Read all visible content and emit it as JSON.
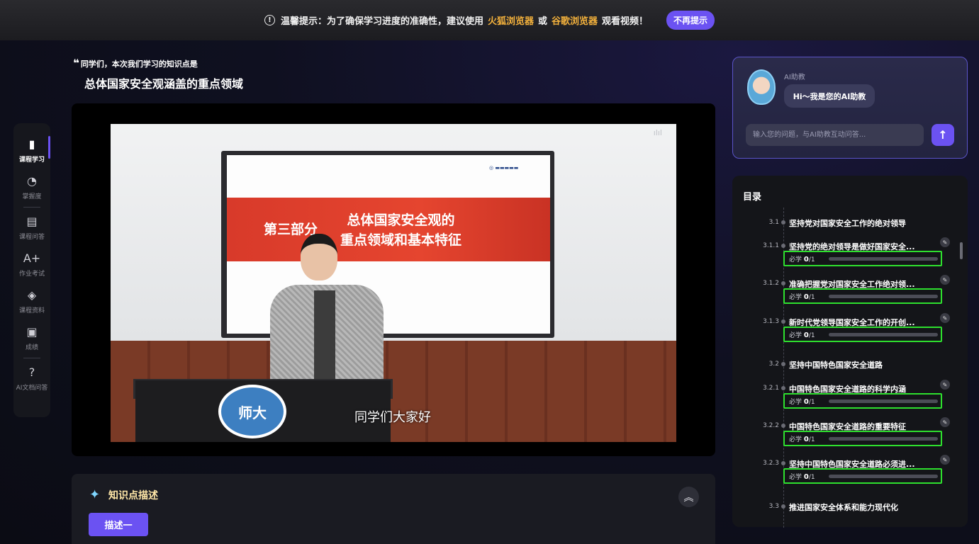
{
  "notice": {
    "prefix": "温馨提示：为了确保学习进度的准确性，建议使用",
    "browser1": "火狐浏览器",
    "or": "或",
    "browser2": "谷歌浏览器",
    "suffix": "观看视频！",
    "dismiss": "不再提示"
  },
  "sidebar": {
    "items": [
      {
        "label": "课程学习",
        "icon": "book-icon",
        "glyph": "▮"
      },
      {
        "label": "掌握度",
        "icon": "pie-chart-icon",
        "glyph": "◔"
      },
      {
        "label": "课程问答",
        "icon": "chat-icon",
        "glyph": "▤"
      },
      {
        "label": "作业考试",
        "icon": "grade-icon",
        "glyph": "A+"
      },
      {
        "label": "课程资料",
        "icon": "code-file-icon",
        "glyph": "◈"
      },
      {
        "label": "成绩",
        "icon": "scoreboard-icon",
        "glyph": "▣"
      },
      {
        "label": "AI文档问答",
        "icon": "ai-doc-icon",
        "glyph": "?"
      }
    ]
  },
  "knowledge": {
    "intro": "同学们，本次我们学习的知识点是",
    "title": "总体国家安全观涵盖的重点领域"
  },
  "video": {
    "slide_part": "第三部分",
    "slide_title_1": "总体国家安全观的",
    "slide_title_2": "重点领域和基本特征",
    "subtitle": "同学们大家好",
    "seal_text": "师大"
  },
  "description": {
    "title": "知识点描述",
    "tab": "描述一"
  },
  "ai": {
    "label": "AI助教",
    "greeting": "Hi～我是您的AI助教",
    "placeholder": "输入您的问题，与AI助教互动问答..."
  },
  "toc": {
    "title": "目录",
    "required_label": "必学",
    "rows": [
      {
        "num": "3.1",
        "text": "坚持党对国家安全工作的绝对领导"
      },
      {
        "num": "3.1.1",
        "text": "坚持党的绝对领导是做好国家安全...",
        "done": "0",
        "total": "/1",
        "progress": 0
      },
      {
        "num": "3.1.2",
        "text": "准确把握党对国家安全工作绝对领...",
        "done": "0",
        "total": "/1",
        "progress": 0
      },
      {
        "num": "3.1.3",
        "text": "新时代党领导国家安全工作的开创...",
        "done": "0",
        "total": "/1",
        "progress": 0
      },
      {
        "num": "3.2",
        "text": "坚持中国特色国家安全道路"
      },
      {
        "num": "3.2.1",
        "text": "中国特色国家安全道路的科学内涵",
        "done": "0",
        "total": "/1",
        "progress": 0
      },
      {
        "num": "3.2.2",
        "text": "中国特色国家安全道路的重要特征",
        "done": "0",
        "total": "/1",
        "progress": 0
      },
      {
        "num": "3.2.3",
        "text": "坚持中国特色国家安全道路必须进...",
        "done": "0",
        "total": "/1",
        "progress": 0
      },
      {
        "num": "3.3",
        "text": "推进国家安全体系和能力现代化"
      }
    ]
  },
  "colors": {
    "accent": "#6b52f2",
    "highlight": "#f3b13c",
    "progress_outline": "#2ee02e"
  }
}
